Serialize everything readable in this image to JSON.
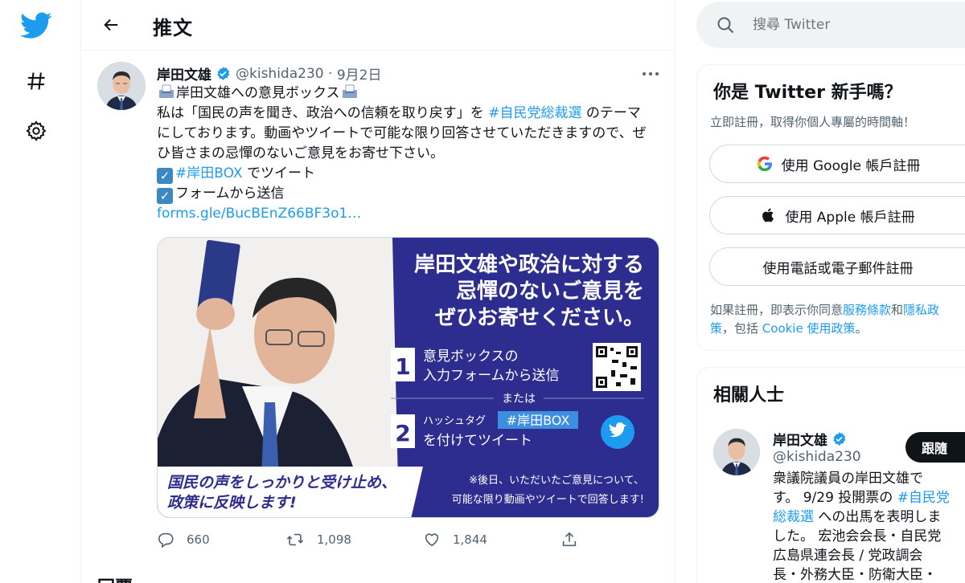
{
  "header": {
    "title": "推文"
  },
  "tweet": {
    "author_name": "岸田文雄",
    "author_handle": "@kishida230",
    "separator": "·",
    "date": "9月2日",
    "lines": {
      "l1": "岸田文雄への意見ボックス",
      "l2_a": "私は「国民の声を聞き、政治への信頼を取り戻す」を ",
      "l2_tag": "#自民党総裁選",
      "l2_b": " のテーマ",
      "l3": "にしております。動画やツイートで可能な限り回答させていただきますので、ぜ",
      "l4": "ひ皆さまの忌憚のないご意見をお寄せ下さい。",
      "l5_tag": "#岸田BOX",
      "l5_b": " でツイート",
      "l6": "フォームから送信",
      "link": "forms.gle/BucBEnZ66BF3o1…"
    },
    "media": {
      "headline_1": "岸田文雄や政治に対する",
      "headline_2": "忌憚のないご意見を",
      "headline_3": "ぜひお寄せください。",
      "step1_num": "1",
      "step1_a": "意見ボックスの",
      "step1_b": "入力フォームから送信",
      "or": "または",
      "step2_num": "2",
      "step2_a": "ハッシュタグ",
      "step2_tag": "#岸田BOX",
      "step2_b": "を付けてツイート",
      "banner_1": "国民の声をしっかりと受け止め、",
      "banner_2": "政策に反映します!",
      "note_1": "※後日、いただいたご意見について、",
      "note_2": "可能な限り動画やツイートで回答します!",
      "colors": {
        "panel": "#2d2d8f",
        "tag_bg": "#3c8fe0",
        "twitter_blue": "#1d9bf0"
      }
    },
    "actions": {
      "replies": "660",
      "retweets": "1,098",
      "likes": "1,844"
    }
  },
  "reply_section": {
    "label": "回覆"
  },
  "search": {
    "placeholder": "搜尋 Twitter"
  },
  "signup": {
    "title": "你是 Twitter 新手嗎？",
    "subtitle": "立即註冊，取得你個人專屬的時間軸！",
    "google_label": "使用 Google 帳戶註冊",
    "apple_label": "使用 Apple 帳戶註冊",
    "phone_label": "使用電話或電子郵件註冊",
    "legal_1": "如果註冊，即表示你同意",
    "legal_terms": "服務條款",
    "legal_and": "和",
    "legal_privacy_1": "隱私政",
    "legal_privacy_2": "策",
    "legal_2": "，包括 ",
    "legal_cookie": "Cookie 使用政策",
    "legal_end": "。"
  },
  "related": {
    "title": "相關人士",
    "name": "岸田文雄",
    "handle": "@kishida230",
    "follow_label": "跟隨",
    "bio_1": "衆議院議員の岸田文雄で",
    "bio_2a": "す。 9/29 投開票の ",
    "bio_2tag": "#自民党",
    "bio_3tag": "総裁選",
    "bio_3b": " への出馬を表明しま",
    "bio_4": "した。 宏池会会長・自民党",
    "bio_5": "広島県連会長 / 党政調会",
    "bio_6": "長・外務大臣・防衛大臣・"
  },
  "icons": {
    "logo": "twitter-bird-icon",
    "explore": "hashtag-icon",
    "settings": "gear-icon",
    "back": "arrow-left-icon",
    "search": "search-icon",
    "reply": "reply-icon",
    "retweet": "retweet-icon",
    "like": "heart-icon",
    "share": "share-icon"
  },
  "colors": {
    "accent": "#1d9bf0",
    "text": "#0f1419",
    "muted": "#536471",
    "border": "#eff3f4"
  }
}
